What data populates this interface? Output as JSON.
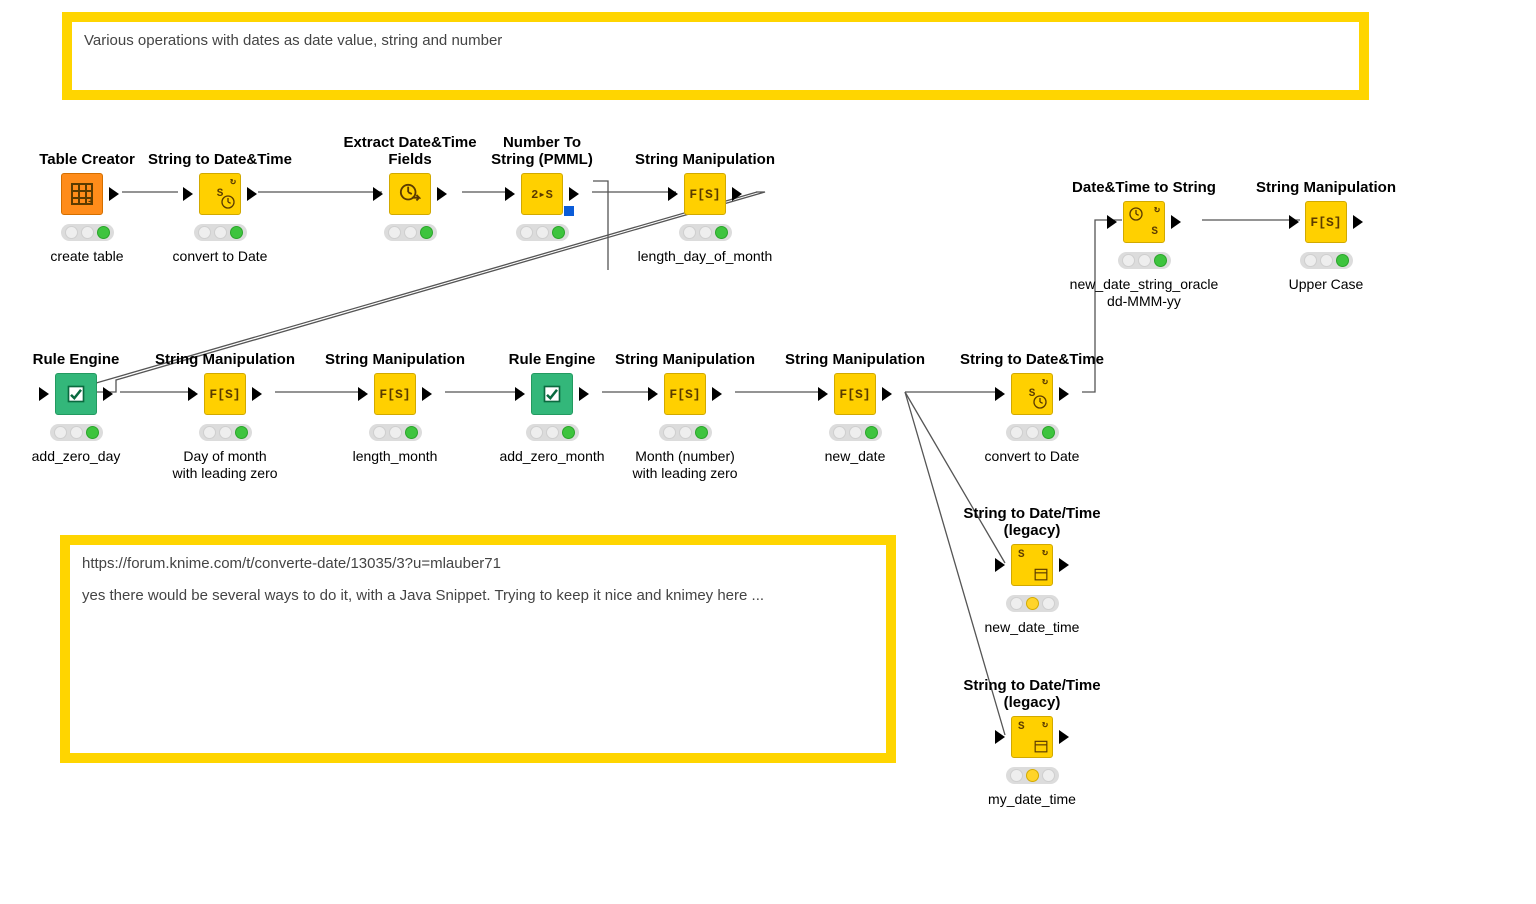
{
  "annotations": {
    "top": {
      "text": "Various operations with dates as date value, string and number"
    },
    "bottom": {
      "line1": "https://forum.knime.com/t/converte-date/13035/3?u=mlauber71",
      "line2": "yes there would be several ways to do it, with a Java Snippet. Trying to keep it nice and knimey here ..."
    }
  },
  "nodes": {
    "tableCreator": {
      "title": "Table Creator",
      "label": "create table",
      "status": "green",
      "glyph": "grid",
      "color": "orange"
    },
    "stringToDate1": {
      "title": "String to Date&Time",
      "label": "convert to Date",
      "status": "green",
      "glyph": "s_clock",
      "color": "yellow"
    },
    "extractFields": {
      "title": "Extract Date&Time\nFields",
      "label": "",
      "status": "green",
      "glyph": "clock_arrow",
      "color": "yellow"
    },
    "numberToString": {
      "title": "Number To\nString (PMML)",
      "label": "",
      "status": "green",
      "glyph": "2s",
      "color": "yellow"
    },
    "strManip1": {
      "title": "String Manipulation",
      "label": "length_day_of_month",
      "status": "green",
      "glyph": "fs",
      "color": "yellow"
    },
    "ruleEngine1": {
      "title": "Rule Engine",
      "label": "add_zero_day",
      "status": "green",
      "glyph": "rule",
      "color": "green"
    },
    "strManip2": {
      "title": "String Manipulation",
      "label": "Day of month\nwith leading zero",
      "status": "green",
      "glyph": "fs",
      "color": "yellow"
    },
    "strManip3": {
      "title": "String Manipulation",
      "label": "length_month",
      "status": "green",
      "glyph": "fs",
      "color": "yellow"
    },
    "ruleEngine2": {
      "title": "Rule Engine",
      "label": "add_zero_month",
      "status": "green",
      "glyph": "rule",
      "color": "green"
    },
    "strManip4": {
      "title": "String Manipulation",
      "label": "Month (number)\nwith leading zero",
      "status": "green",
      "glyph": "fs",
      "color": "yellow"
    },
    "strManip5": {
      "title": "String Manipulation",
      "label": "new_date",
      "status": "green",
      "glyph": "fs",
      "color": "yellow"
    },
    "stringToDate2": {
      "title": "String to Date&Time",
      "label": "convert to Date",
      "status": "green",
      "glyph": "s_clock",
      "color": "yellow"
    },
    "dateToString": {
      "title": "Date&Time to String",
      "label": "new_date_string_oracle\ndd-MMM-yy",
      "status": "green",
      "glyph": "clock_s",
      "color": "yellow"
    },
    "strManip6": {
      "title": "String Manipulation",
      "label": "Upper Case",
      "status": "green",
      "glyph": "fs",
      "color": "yellow"
    },
    "stringToDateLeg1": {
      "title": "String to Date/Time\n(legacy)",
      "label": "new_date_time",
      "status": "yellow",
      "glyph": "s_table",
      "color": "yellow"
    },
    "stringToDateLeg2": {
      "title": "String to Date/Time\n(legacy)",
      "label": "my_date_time",
      "status": "yellow",
      "glyph": "s_table",
      "color": "yellow"
    }
  }
}
